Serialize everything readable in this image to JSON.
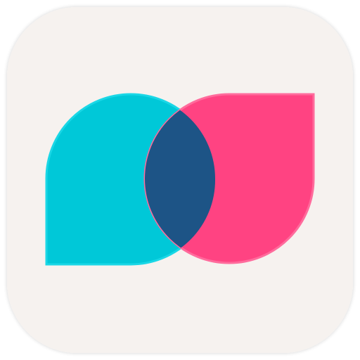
{
  "icon": {
    "name": "tandem-app-icon",
    "colors": {
      "tile_background": "#f6f2ef",
      "left_bubble": "#00c8d8",
      "left_bubble_edge": "#1ad7e6",
      "right_bubble": "#ff4382",
      "right_bubble_edge": "#ff6b9c",
      "overlap": "#1d5486"
    }
  }
}
